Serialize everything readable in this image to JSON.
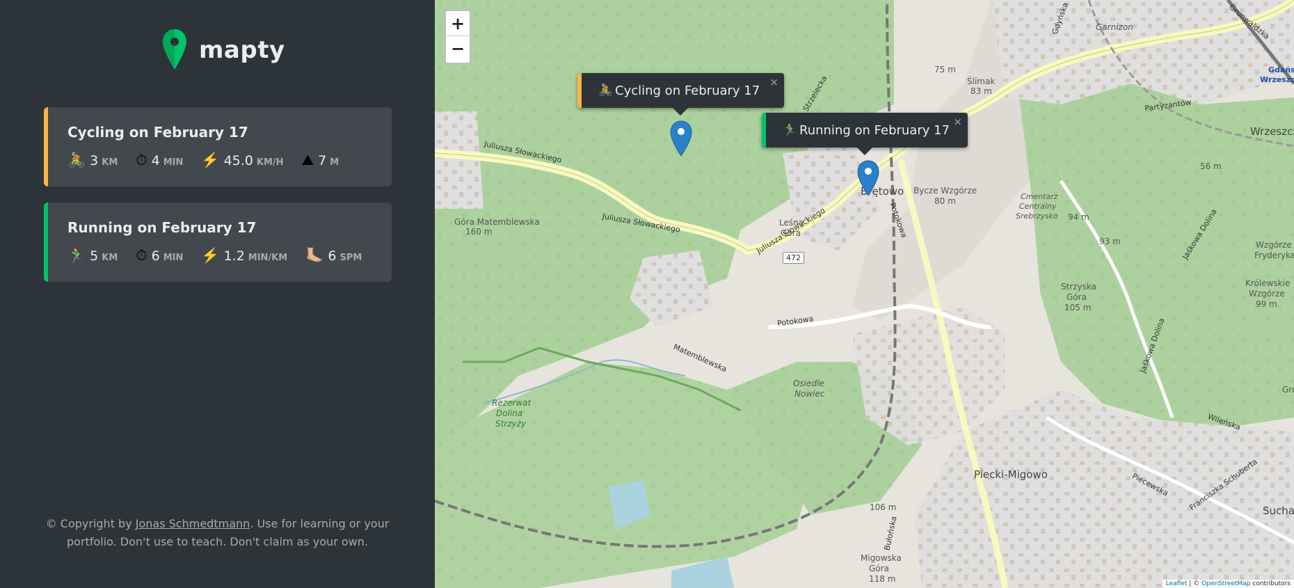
{
  "logo": {
    "text": "mapty",
    "icon": "map-pin-icon"
  },
  "workouts": [
    {
      "type": "cycling",
      "title": "Cycling on February 17",
      "color": "#ffb545",
      "details": [
        {
          "icon": "🚴",
          "value": "3",
          "unit": "km"
        },
        {
          "icon": "⏱",
          "value": "4",
          "unit": "min"
        },
        {
          "icon": "⚡️",
          "value": "45.0",
          "unit": "km/h"
        },
        {
          "icon": "⛰",
          "value": "7",
          "unit": "m"
        }
      ]
    },
    {
      "type": "running",
      "title": "Running on February 17",
      "color": "#00c46a",
      "details": [
        {
          "icon": "🏃‍♂️",
          "value": "5",
          "unit": "km"
        },
        {
          "icon": "⏱",
          "value": "6",
          "unit": "min"
        },
        {
          "icon": "⚡️",
          "value": "1.2",
          "unit": "min/km"
        },
        {
          "icon": "🦶🏼",
          "value": "6",
          "unit": "spm"
        }
      ]
    }
  ],
  "copyright": {
    "prefix": "© Copyright by ",
    "author": "Jonas Schmedtmann",
    "suffix": ". Use for learning or your portfolio. Don't use to teach. Don't claim as your own."
  },
  "map": {
    "zoom_in": "+",
    "zoom_out": "−",
    "popups": [
      {
        "icon": "🚴",
        "text": "Cycling on February 17",
        "close": "×"
      },
      {
        "icon": "🏃‍♂️",
        "text": "Running on February 17",
        "close": "×"
      }
    ],
    "labels": {
      "gora": "Góra Matemblewska",
      "gora_h": "160 m",
      "slowackiego1": "Juliusza Słowackiego",
      "slowackiego2": "Juliusza Słowackiego",
      "slowackiego3": "Juliusza Słowackiego",
      "lesna": "Leśna",
      "lesna2": "Góra",
      "road472": "472",
      "bretowo": "Brętowo",
      "bycze": "Bycze Wzgórze",
      "bycze_h": "80 m",
      "potokowa": "Potokowa",
      "potokowa2": "Potokowa",
      "matemblewska": "Matemblewska",
      "rezerwat": "Rezerwat",
      "rezerwat2": "Dolina",
      "rezerwat3": "Strzyży",
      "osiedle": "Osiedle",
      "osiedle2": "Nowiec",
      "piecki": "Piecki-Migowo",
      "cmentarz": "Cmentarz",
      "cmentarz2": "Centralny",
      "cmentarz3": "Srebrzysko",
      "strzyska": "Strzyska",
      "strzyska2": "Góra",
      "strzyska_h": "105 m",
      "wrzeszcz": "Wrzeszcz",
      "gdansk": "Gdańsk",
      "gdansk2": "Wrzeszcz",
      "slimak": "Ślimak",
      "slimak_h": "83 m",
      "h75": "75 m",
      "garnizon": "Garnizon",
      "partyzantow": "Partyzantów",
      "h56": "56 m",
      "h94": "94 m",
      "h93": "93 m",
      "wzgorze": "Wzgórze",
      "wzgorze2": "Fryderyka",
      "krolewskie": "Królewskie",
      "krolewskie2": "Wzgórze",
      "krolewskie_h": "99 m",
      "jaskowa": "Jaśkowa Dolina",
      "jaskowa2": "Jaśkowa Dolina",
      "wilenska": "Wileńska",
      "piecewska": "Piecewska",
      "franciszka": "Franciszka Schuberta",
      "sucha": "Sucha",
      "h106": "106 m",
      "migowska": "Migowska",
      "migowska2": "Góra",
      "migowska_h": "118 m",
      "bulonska": "Bułońska",
      "gdynska": "Gdyńska",
      "grunwaldzka": "Grunwaldzka",
      "strzelecka": "Strzelecka",
      "grot": "Gro"
    },
    "attribution": {
      "leaflet": "Leaflet",
      "sep": " | © ",
      "osm": "OpenStreetMap",
      "suffix": " contributors"
    }
  }
}
